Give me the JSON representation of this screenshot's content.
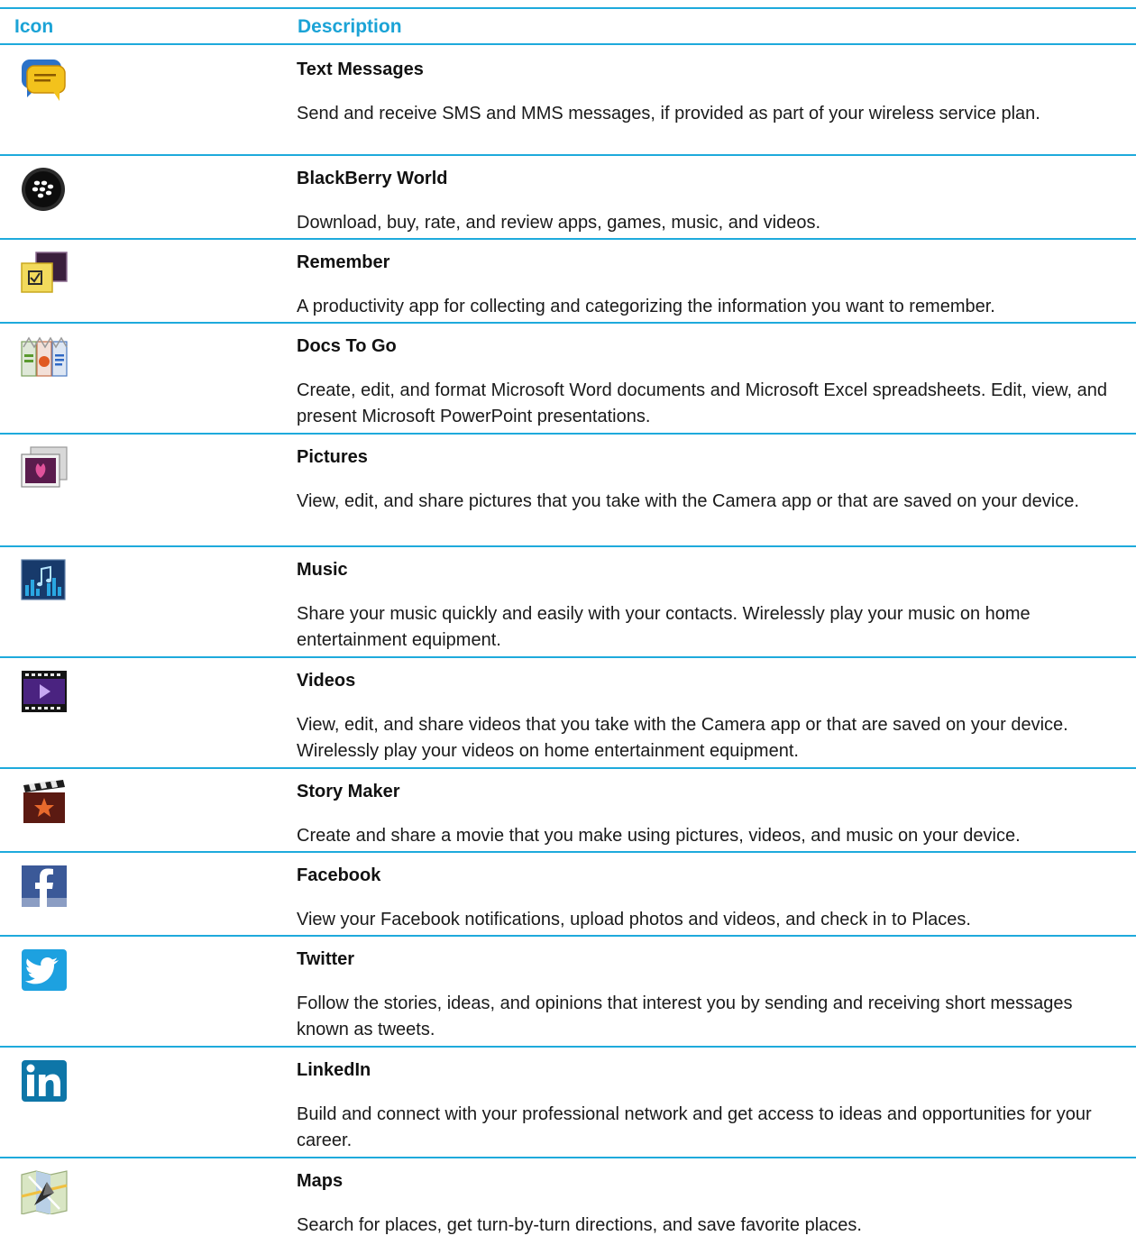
{
  "table": {
    "header": {
      "icon": "Icon",
      "description": "Description"
    },
    "rows": [
      {
        "icon": "text-messages-icon",
        "title": "Text Messages",
        "description": "Send and receive SMS and MMS messages, if provided as part of your wireless service plan."
      },
      {
        "icon": "blackberry-world-icon",
        "title": "BlackBerry World",
        "description": "Download, buy, rate, and review apps, games, music, and videos."
      },
      {
        "icon": "remember-icon",
        "title": "Remember",
        "description": "A productivity app for collecting and categorizing the information you want to remember."
      },
      {
        "icon": "docs-to-go-icon",
        "title": "Docs To Go",
        "description": "Create, edit, and format Microsoft Word documents and Microsoft Excel spreadsheets. Edit, view, and present Microsoft PowerPoint presentations."
      },
      {
        "icon": "pictures-icon",
        "title": "Pictures",
        "description": "View, edit, and share pictures that you take with the Camera app or that are saved on your device."
      },
      {
        "icon": "music-icon",
        "title": "Music",
        "description": "Share your music quickly and easily with your contacts. Wirelessly play your music on home entertainment equipment."
      },
      {
        "icon": "videos-icon",
        "title": "Videos",
        "description": "View, edit, and share videos that you take with the Camera app or that are saved on your device. Wirelessly play your videos on home entertainment equipment."
      },
      {
        "icon": "story-maker-icon",
        "title": "Story Maker",
        "description": "Create and share a movie that you make using pictures, videos, and music on your device."
      },
      {
        "icon": "facebook-icon",
        "title": "Facebook",
        "description": "View your Facebook notifications, upload photos and videos, and check in to Places."
      },
      {
        "icon": "twitter-icon",
        "title": "Twitter",
        "description": "Follow the stories, ideas, and opinions that interest you by sending and receiving short messages known as tweets."
      },
      {
        "icon": "linkedin-icon",
        "title": "LinkedIn",
        "description": "Build and connect with your professional network and get access to ideas and opportunities for your career."
      },
      {
        "icon": "maps-icon",
        "title": "Maps",
        "description": "Search for places, get turn-by-turn directions, and save favorite places."
      }
    ]
  },
  "colors": {
    "rule": "#1eaadc",
    "header_text": "#1ba3d6"
  }
}
